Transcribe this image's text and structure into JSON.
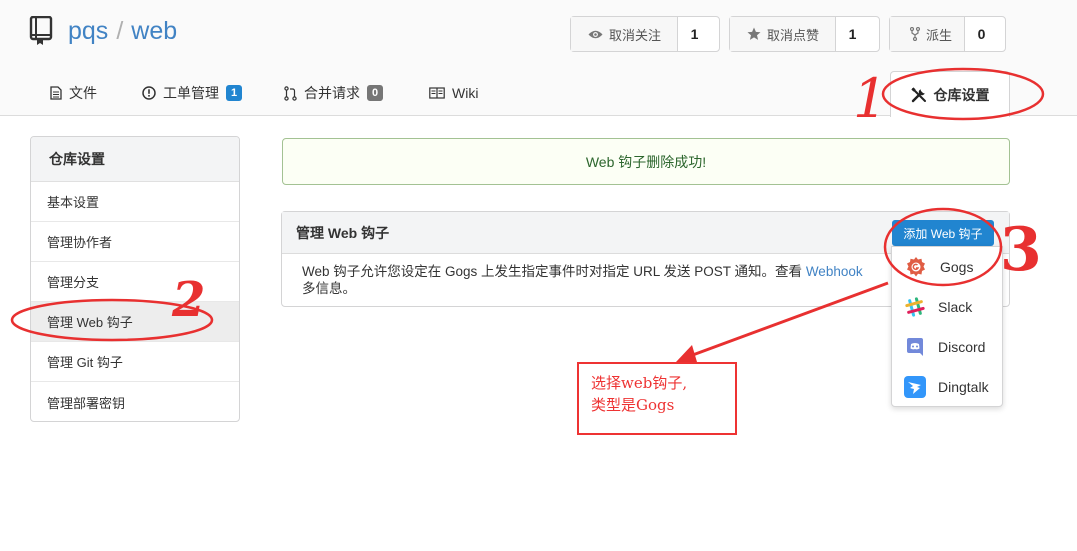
{
  "repo": {
    "owner": "pqs",
    "separator": "/",
    "name": "web"
  },
  "actions": {
    "watch": {
      "label": "取消关注",
      "count": "1"
    },
    "star": {
      "label": "取消点赞",
      "count": "1"
    },
    "fork": {
      "label": "派生",
      "count": "0"
    }
  },
  "tabs": {
    "files": {
      "label": "文件"
    },
    "issues": {
      "label": "工单管理",
      "count": "1"
    },
    "pulls": {
      "label": "合并请求",
      "count": "0"
    },
    "wiki": {
      "label": "Wiki"
    },
    "settings": {
      "label": "仓库设置"
    }
  },
  "sidebar": {
    "title": "仓库设置",
    "items": [
      {
        "label": "基本设置"
      },
      {
        "label": "管理协作者"
      },
      {
        "label": "管理分支"
      },
      {
        "label": "管理 Web 钩子"
      },
      {
        "label": "管理 Git 钩子"
      },
      {
        "label": "管理部署密钥"
      }
    ]
  },
  "flash": {
    "message": "Web 钩子删除成功!"
  },
  "webhooks": {
    "title": "管理 Web 钩子",
    "add_label": "添加 Web 钩子",
    "description": "Web 钩子允许您设定在 Gogs 上发生指定事件时对指定 URL 发送 POST 通知。查看 ",
    "link_text": "Webhook",
    "description_end": "多信息。",
    "types": [
      {
        "label": "Gogs",
        "icon": "gogs-icon"
      },
      {
        "label": "Slack",
        "icon": "slack-icon"
      },
      {
        "label": "Discord",
        "icon": "discord-icon"
      },
      {
        "label": "Dingtalk",
        "icon": "dingtalk-icon"
      }
    ]
  },
  "annotations": {
    "step1": "1",
    "step2": "2",
    "step3": "3",
    "note_line1": "选择web钩子,",
    "note_line2": "类型是Gogs",
    "color": "#e83030"
  },
  "colors": {
    "primary": "#2185d0",
    "link": "#4183c4",
    "success_text": "#2c662d"
  }
}
